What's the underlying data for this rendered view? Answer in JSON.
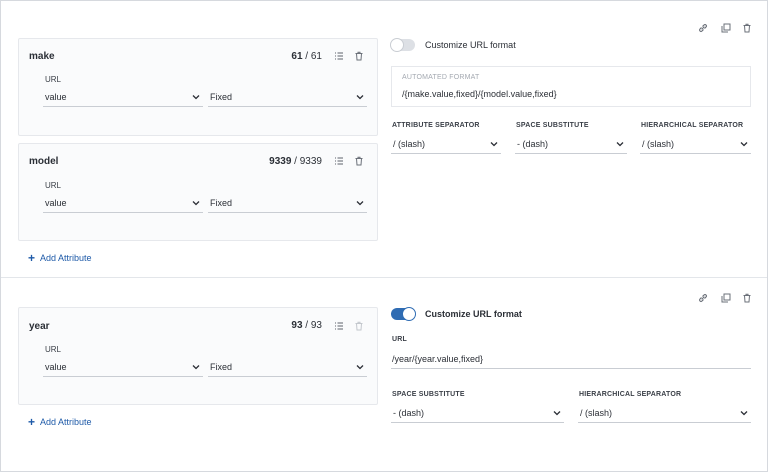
{
  "colors": {
    "accent": "#1e5aa8",
    "toggle_on": "#2f6cb3",
    "toggle_off": "#dde0e5",
    "panel_bg": "#fafbfc",
    "border": "#e6e8ec"
  },
  "icons": {
    "copy_link": "link-icon",
    "duplicate": "duplicate-icon",
    "delete": "trash-icon",
    "list": "list-icon",
    "dropdown": "chevron-down-icon",
    "add": "plus-icon"
  },
  "group1": {
    "attributes": [
      {
        "name": "make",
        "count_shown": "61",
        "count_total": "61",
        "url_label": "URL",
        "field_value": "value",
        "mode_value": "Fixed"
      },
      {
        "name": "model",
        "count_shown": "9339",
        "count_total": "9339",
        "url_label": "URL",
        "field_value": "value",
        "mode_value": "Fixed"
      }
    ],
    "add_attribute_label": "Add Attribute",
    "customize_toggle": {
      "on": false,
      "label": "Customize URL format"
    },
    "automated_format": {
      "title": "AUTOMATED FORMAT",
      "value": "/{make.value,fixed}/{model.value,fixed}"
    },
    "attribute_separator": {
      "label": "ATTRIBUTE SEPARATOR",
      "value": "/ (slash)"
    },
    "space_substitute": {
      "label": "SPACE SUBSTITUTE",
      "value": "- (dash)"
    },
    "hierarchical_separator": {
      "label": "HIERARCHICAL SEPARATOR",
      "value": "/ (slash)"
    }
  },
  "group2": {
    "attributes": [
      {
        "name": "year",
        "count_shown": "93",
        "count_total": "93",
        "url_label": "URL",
        "field_value": "value",
        "mode_value": "Fixed"
      }
    ],
    "add_attribute_label": "Add Attribute",
    "customize_toggle": {
      "on": true,
      "label": "Customize URL format"
    },
    "url": {
      "label": "URL",
      "value": "/year/{year.value,fixed}"
    },
    "space_substitute": {
      "label": "SPACE SUBSTITUTE",
      "value": "- (dash)"
    },
    "hierarchical_separator": {
      "label": "HIERARCHICAL SEPARATOR",
      "value": "/ (slash)"
    }
  }
}
